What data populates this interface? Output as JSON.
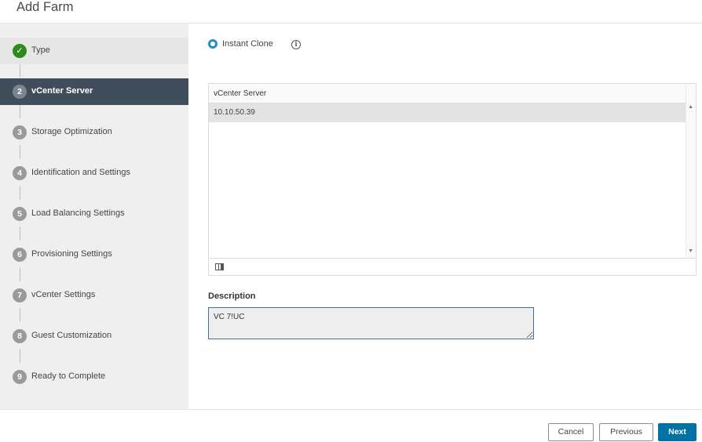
{
  "window": {
    "title": "Add Farm"
  },
  "wizard": {
    "steps": [
      {
        "number": "✓",
        "label": "Type",
        "state": "completed"
      },
      {
        "number": "2",
        "label": "vCenter Server",
        "state": "active"
      },
      {
        "number": "3",
        "label": "Storage Optimization",
        "state": "pending"
      },
      {
        "number": "4",
        "label": "Identification and Settings",
        "state": "pending"
      },
      {
        "number": "5",
        "label": "Load Balancing Settings",
        "state": "pending"
      },
      {
        "number": "6",
        "label": "Provisioning Settings",
        "state": "pending"
      },
      {
        "number": "7",
        "label": "vCenter Settings",
        "state": "pending"
      },
      {
        "number": "8",
        "label": "Guest Customization",
        "state": "pending"
      },
      {
        "number": "9",
        "label": "Ready to Complete",
        "state": "pending"
      }
    ]
  },
  "clone_option": {
    "label": "Instant Clone",
    "selected": true,
    "info_icon": "i"
  },
  "grid": {
    "column_header": "vCenter Server",
    "rows": [
      {
        "value": "10.10.50.39",
        "selected": true
      }
    ],
    "footer_icon": "columns-icon"
  },
  "description": {
    "label": "Description",
    "value": "VC 7!UC"
  },
  "buttons": {
    "cancel": "Cancel",
    "previous": "Previous",
    "next": "Next"
  },
  "colors": {
    "accent": "#0072a3",
    "active_step_bg": "#404d5a",
    "completed_step": "#2f8a1d",
    "radio": "#2b8ac6"
  }
}
